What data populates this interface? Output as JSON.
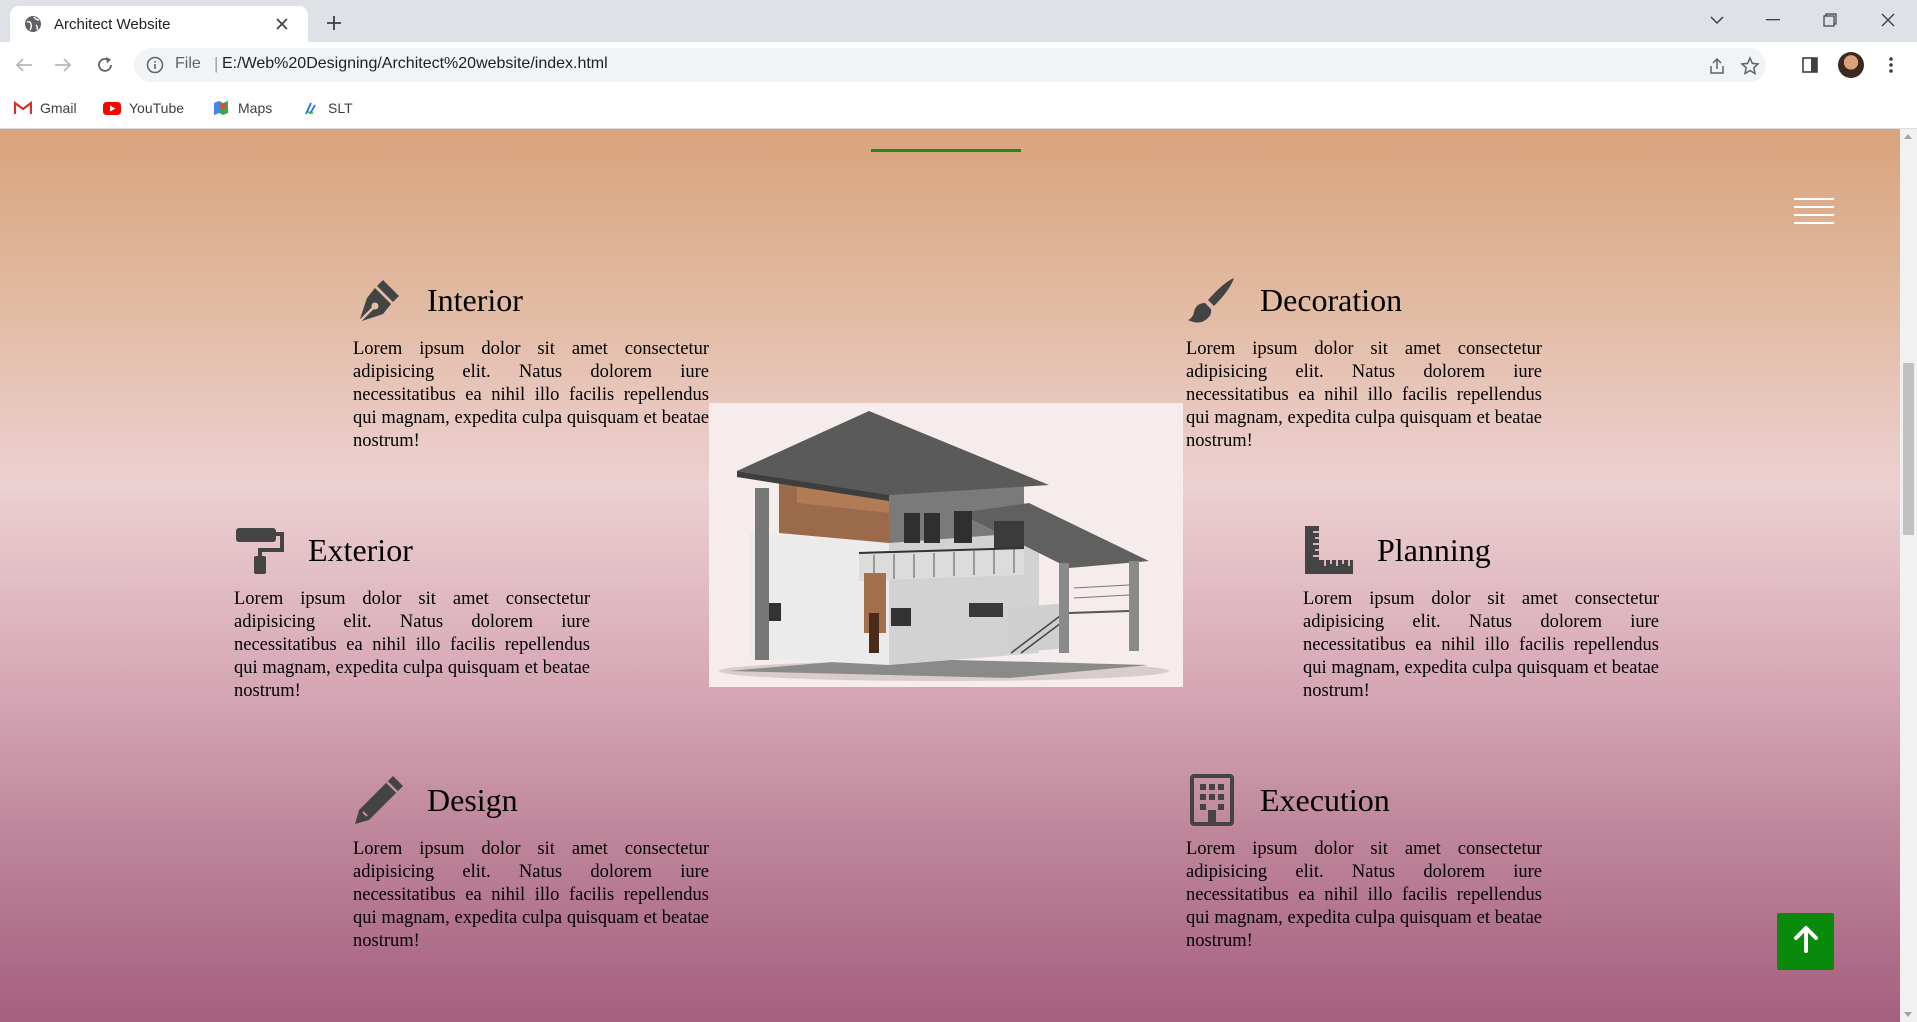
{
  "browser": {
    "tab_title": "Architect Website",
    "scheme_label": "File",
    "url": "E:/Web%20Designing/Architect%20website/index.html",
    "bookmarks": [
      {
        "label": "Gmail",
        "icon": "gmail-icon"
      },
      {
        "label": "YouTube",
        "icon": "youtube-icon"
      },
      {
        "label": "Maps",
        "icon": "maps-icon"
      },
      {
        "label": "SLT",
        "icon": "slt-icon"
      }
    ]
  },
  "page": {
    "accent_color": "#1b8a1b",
    "button_color": "#0a8a0a",
    "services": [
      {
        "title": "Interior",
        "icon": "pen-nib-icon",
        "text": "Lorem ipsum dolor sit amet consectetur adipisicing elit. Natus dolorem iure necessitatibus ea nihil illo facilis repellendus qui magnam, expedita culpa quisquam et beatae nostrum!"
      },
      {
        "title": "Decoration",
        "icon": "paint-brush-icon",
        "text": "Lorem ipsum dolor sit amet consectetur adipisicing elit. Natus dolorem iure necessitatibus ea nihil illo facilis repellendus qui magnam, expedita culpa quisquam et beatae nostrum!"
      },
      {
        "title": "Exterior",
        "icon": "paint-roller-icon",
        "text": "Lorem ipsum dolor sit amet consectetur adipisicing elit. Natus dolorem iure necessitatibus ea nihil illo facilis repellendus qui magnam, expedita culpa quisquam et beatae nostrum!"
      },
      {
        "title": "Planning",
        "icon": "ruler-combined-icon",
        "text": "Lorem ipsum dolor sit amet consectetur adipisicing elit. Natus dolorem iure necessitatibus ea nihil illo facilis repellendus qui magnam, expedita culpa quisquam et beatae nostrum!"
      },
      {
        "title": "Design",
        "icon": "pencil-icon",
        "text": "Lorem ipsum dolor sit amet consectetur adipisicing elit. Natus dolorem iure necessitatibus ea nihil illo facilis repellendus qui magnam, expedita culpa quisquam et beatae nostrum!"
      },
      {
        "title": "Execution",
        "icon": "building-icon",
        "text": "Lorem ipsum dolor sit amet consectetur adipisicing elit. Natus dolorem iure necessitatibus ea nihil illo facilis repellendus qui magnam, expedita culpa quisquam et beatae nostrum!"
      }
    ]
  }
}
